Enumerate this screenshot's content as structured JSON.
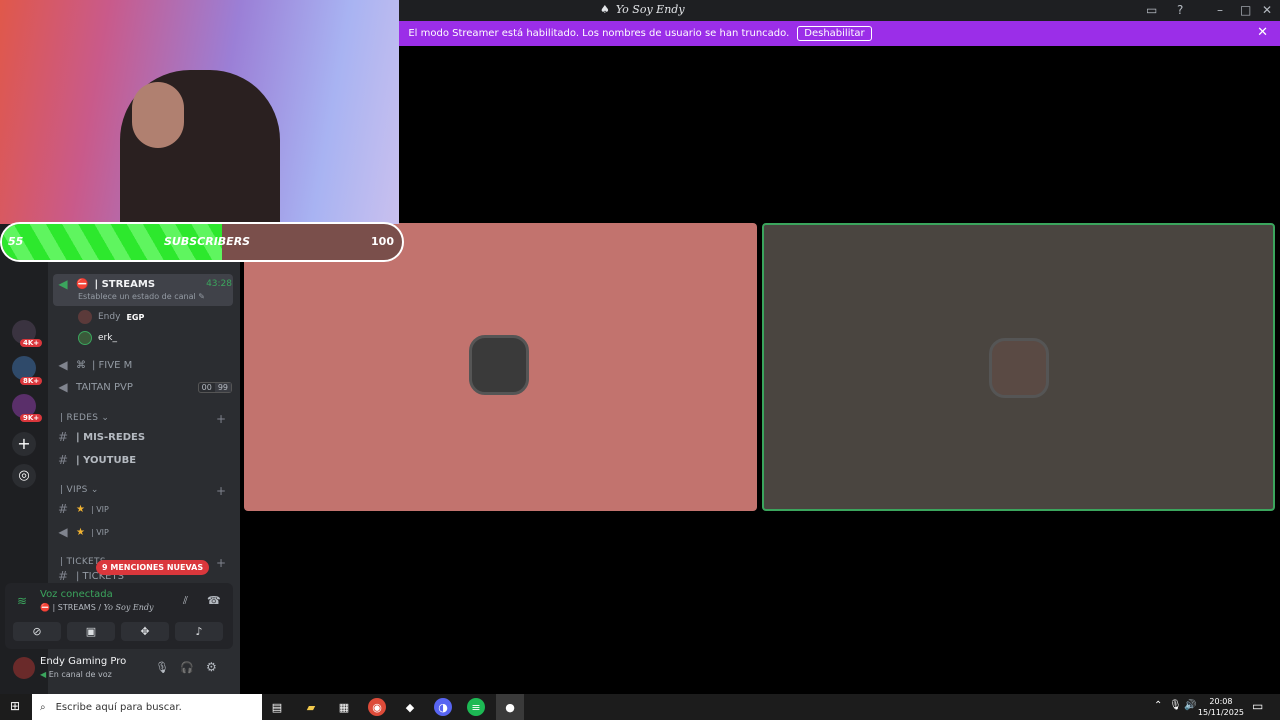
{
  "window": {
    "title": "Yo Soy Endy"
  },
  "banner": {
    "text": "El modo Streamer está habilitado. Los nombres de usuario se han truncado.",
    "button": "Deshabilitar"
  },
  "overlay": {
    "subs_current": "55",
    "subs_label": "SUBSCRIBERS",
    "subs_goal": "100",
    "progress_fraction": 0.55
  },
  "rail": {
    "badges": [
      "4K+",
      "8K+",
      "9K+"
    ]
  },
  "sidebar": {
    "active_channel": {
      "name": "| STREAMS",
      "timer": "43:28",
      "status": "Establece un estado de canal"
    },
    "members": [
      {
        "name": "Endy",
        "tag": "EGP"
      },
      {
        "name": "erk_"
      }
    ],
    "channels": [
      {
        "name": "| FIVE M"
      },
      {
        "name": "TAITAN PVP",
        "count_a": "00",
        "count_b": "99"
      }
    ],
    "categories": [
      {
        "name": "| REDES",
        "items": [
          "| MIS-REDES",
          "| YOUTUBE"
        ]
      },
      {
        "name": "| VIPS",
        "items": [
          "| VIP",
          "| VIP"
        ]
      },
      {
        "name": "| TICKETS",
        "items": [
          "| TICKETS"
        ]
      }
    ],
    "mentions": "9 MENCIONES NUEVAS"
  },
  "voice": {
    "status": "Voz conectada",
    "channel": "| STREAMS / ",
    "server": "Yo Soy Endy"
  },
  "user": {
    "name": "Endy Gaming Pro",
    "status": "En canal de voz"
  },
  "taskbar": {
    "search_placeholder": "Escribe aquí para buscar.",
    "time": "20:08",
    "date": "15/11/2025"
  },
  "colors": {
    "banner": "#9b2ee8",
    "tile1": "#c2736e",
    "tile2": "#4a4540",
    "speaking": "#3ba55d",
    "green": "#2de82d"
  }
}
